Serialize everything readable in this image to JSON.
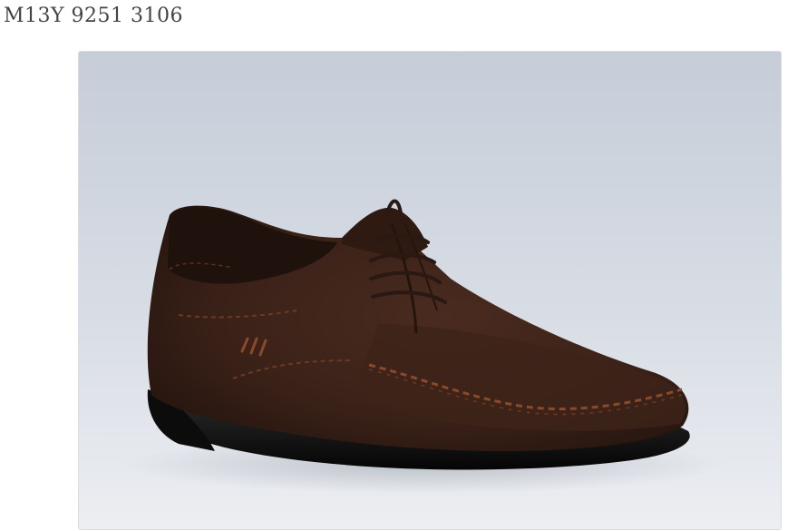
{
  "product": {
    "code": "M13Y 9251 3106"
  },
  "image": {
    "subject": "shoe-photo",
    "colors": {
      "background_top": "#c9d0da",
      "background_bottom": "#eef0f3",
      "suede": "#3a2118",
      "suede_dark": "#24140e",
      "sole": "#111111",
      "stitching": "#8a4a2a",
      "laces": "#2a1812"
    }
  }
}
